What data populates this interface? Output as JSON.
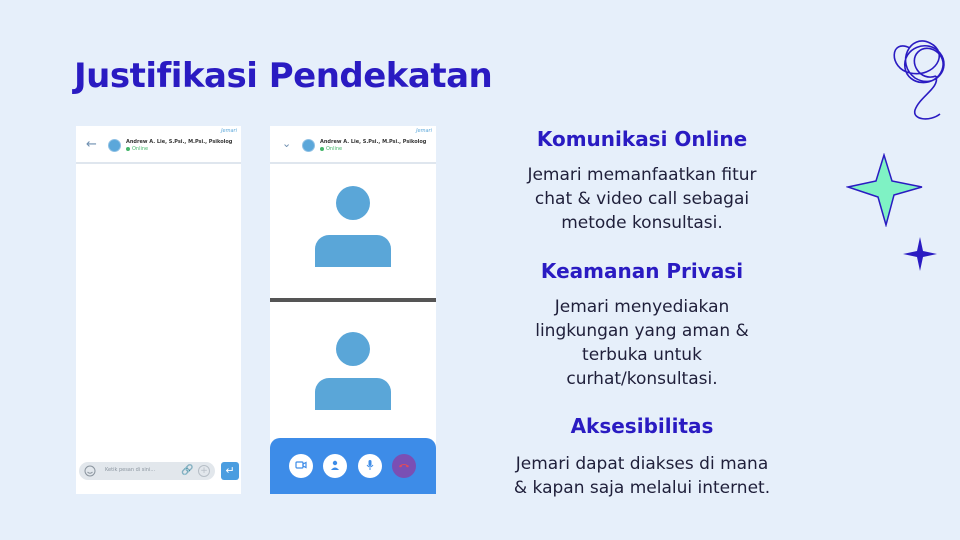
{
  "slide": {
    "title": "Justifikasi Pendekatan"
  },
  "chat_screen": {
    "contact_name": "Andrew A. Lie, S.Psi., M.Psi., Psikolog",
    "status": "Online",
    "brand": "Jemari",
    "input_placeholder": "Ketik pesan di sini..."
  },
  "call_screen": {
    "contact_name": "Andrew A. Lie, S.Psi., M.Psi., Psikolog",
    "status": "Online",
    "brand": "Jemari",
    "controls": [
      "video-camera-icon",
      "switch-camera-icon",
      "microphone-icon",
      "end-call-icon"
    ]
  },
  "sections": [
    {
      "heading": "Komunikasi Online",
      "lines": [
        "Jemari memanfaatkan fitur",
        "chat & video call sebagai",
        "metode konsultasi."
      ]
    },
    {
      "heading": "Keamanan Privasi",
      "lines": [
        "Jemari menyediakan",
        "lingkungan yang aman &",
        "terbuka untuk",
        "curhat/konsultasi."
      ]
    },
    {
      "heading": "Aksesibilitas",
      "lines": [
        "Jemari dapat diakses di mana",
        "& kapan saja melalui internet."
      ]
    }
  ],
  "colors": {
    "background": "#e6effa",
    "accent": "#2a1bc2",
    "call_bar": "#3d8ce8",
    "avatar": "#5aa6d8",
    "sparkle": "#7ff2c4"
  }
}
